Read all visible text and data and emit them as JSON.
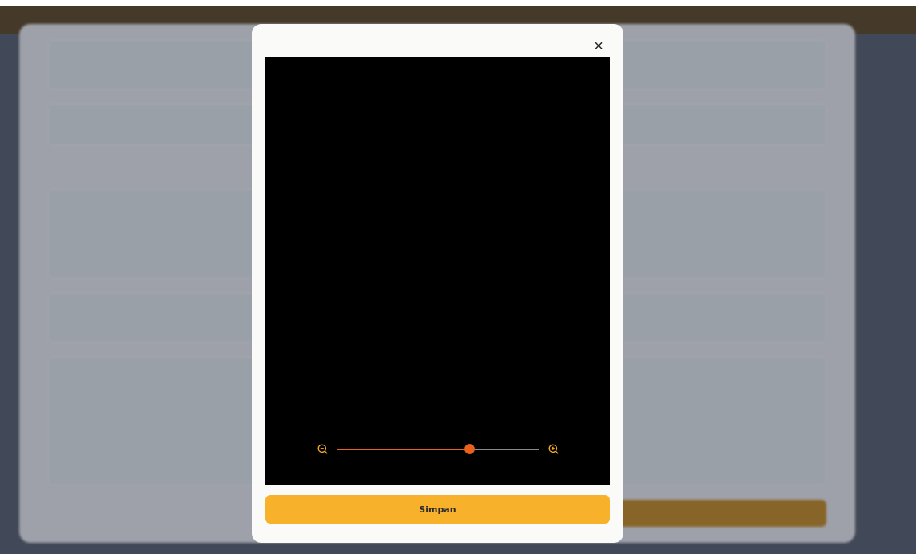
{
  "dialog": {
    "close": "×",
    "crop": {
      "zoom": {
        "level": 0.655
      }
    },
    "button": "Simpan"
  }
}
